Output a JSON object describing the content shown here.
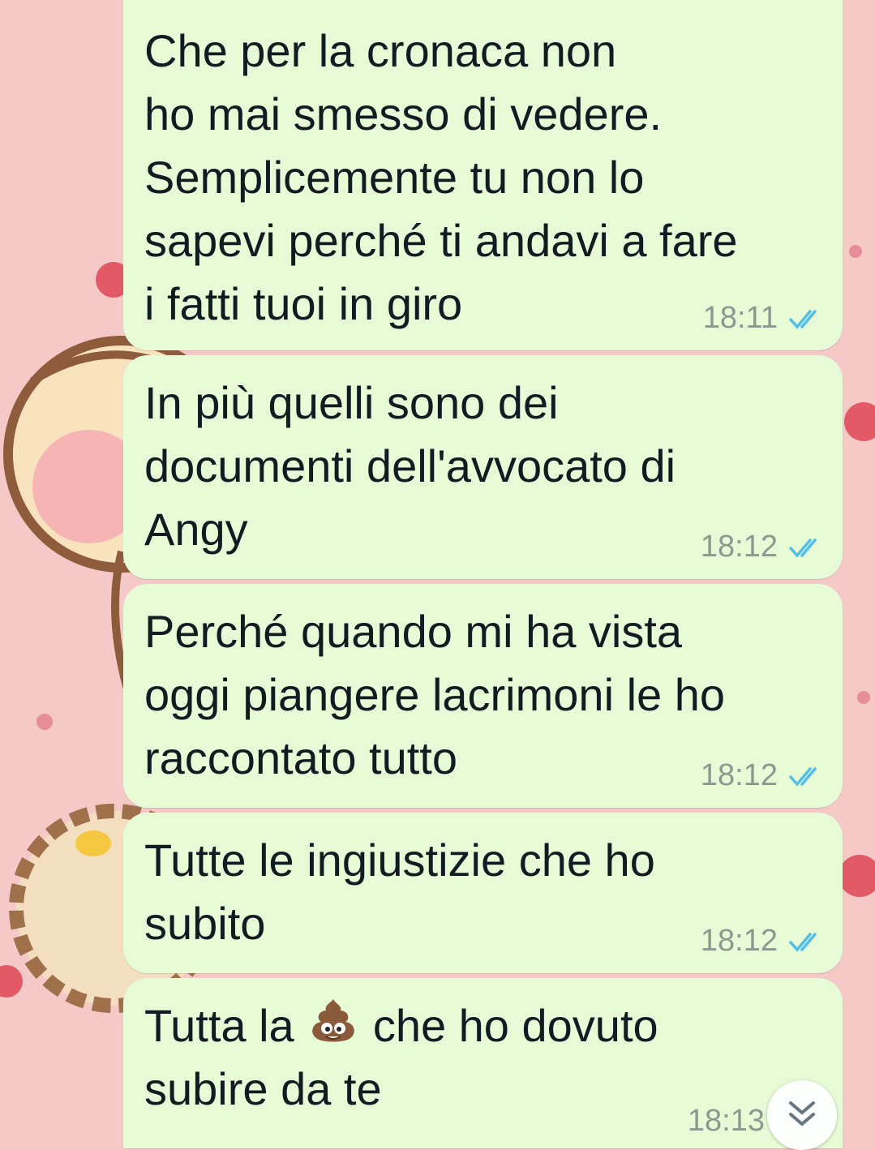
{
  "messages": [
    {
      "text": "Che per la cronaca non\nho mai smesso di vedere.\nSemplicemente tu non lo\nsapevi perché ti andavi a fare\ni fatti tuoi in giro",
      "time": "18:11",
      "status": "read"
    },
    {
      "text": "In più quelli sono dei\ndocumenti dell'avvocato di\nAngy",
      "time": "18:12",
      "status": "read"
    },
    {
      "text": "Perché quando mi ha vista\noggi piangere lacrimoni le ho\nraccontato tutto",
      "time": "18:12",
      "status": "read"
    },
    {
      "text": "Tutte le ingiustizie che ho\nsubito",
      "time": "18:12",
      "status": "read"
    },
    {
      "text_before": "Tutta la",
      "emoji": "pile-of-poo-emoji",
      "text_after": "che ho dovuto",
      "text_line2": "subire da te",
      "time": "18:13",
      "status": "read"
    }
  ],
  "colors": {
    "wallpaper": "#f6c9c9",
    "bubble_out": "#e6fbd6",
    "ticks_read": "#53bdeb",
    "time_text": "#8a9a8f"
  },
  "icons": {
    "read_receipt": "double-check-icon",
    "scroll_down": "chevron-double-down-icon"
  }
}
